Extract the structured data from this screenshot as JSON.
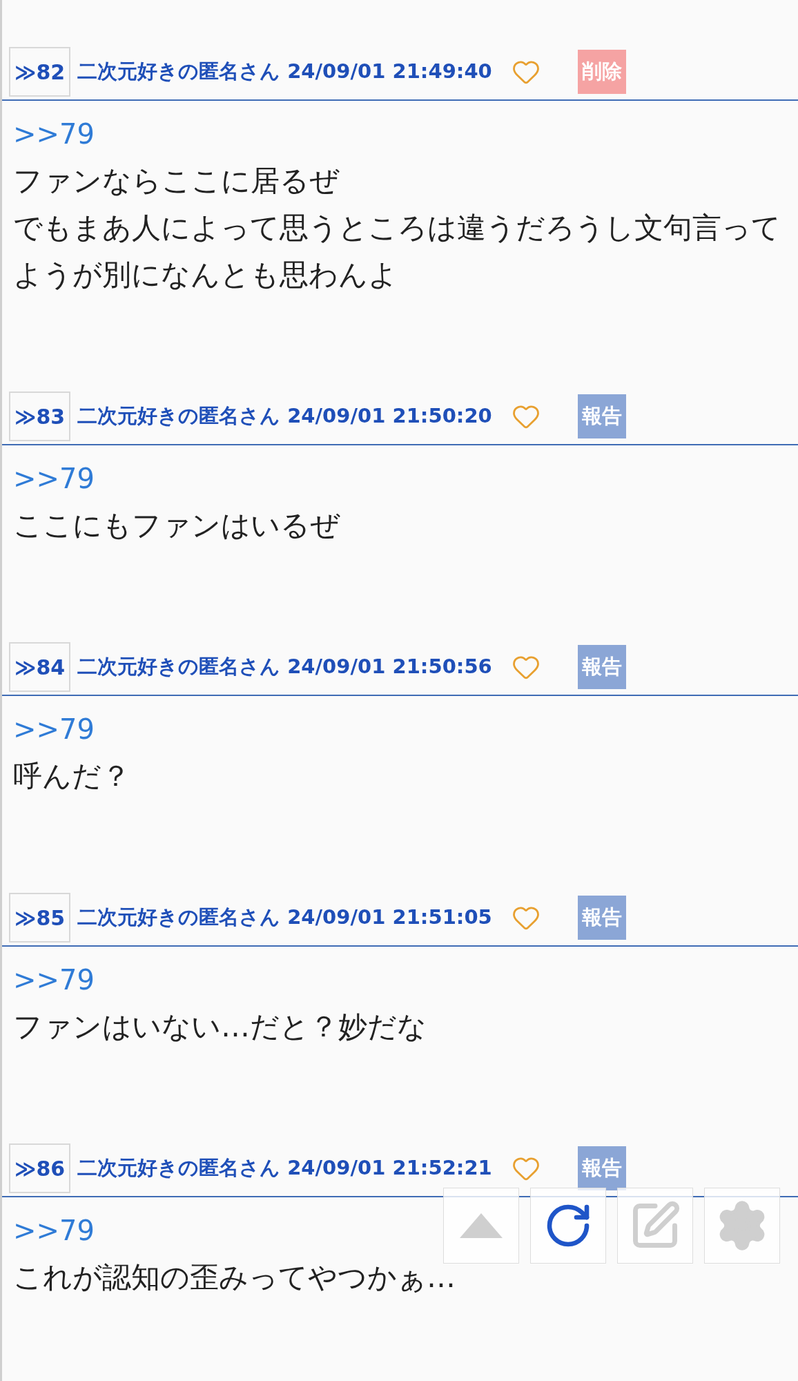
{
  "posts": [
    {
      "number": "≫82",
      "author": "二次元好きの匿名さん",
      "date": "24/09/01 21:49:40",
      "action": {
        "kind": "delete",
        "label": "削除"
      },
      "quote": ">>79",
      "lines": [
        "ファンならここに居るぜ",
        "でもまあ人によって思うところは違うだろうし文句言ってようが別になんとも思わんよ"
      ]
    },
    {
      "number": "≫83",
      "author": "二次元好きの匿名さん",
      "date": "24/09/01 21:50:20",
      "action": {
        "kind": "report",
        "label": "報告"
      },
      "quote": ">>79",
      "lines": [
        "ここにもファンはいるぜ"
      ]
    },
    {
      "number": "≫84",
      "author": "二次元好きの匿名さん",
      "date": "24/09/01 21:50:56",
      "action": {
        "kind": "report",
        "label": "報告"
      },
      "quote": ">>79",
      "lines": [
        "呼んだ？"
      ]
    },
    {
      "number": "≫85",
      "author": "二次元好きの匿名さん",
      "date": "24/09/01 21:51:05",
      "action": {
        "kind": "report",
        "label": "報告"
      },
      "quote": ">>79",
      "lines": [
        "ファンはいない…だと？妙だな"
      ]
    },
    {
      "number": "≫86",
      "author": "二次元好きの匿名さん",
      "date": "24/09/01 21:52:21",
      "action": {
        "kind": "report",
        "label": "報告"
      },
      "quote": ">>79",
      "lines": [
        "これが認知の歪みってやつかぁ…"
      ]
    }
  ]
}
